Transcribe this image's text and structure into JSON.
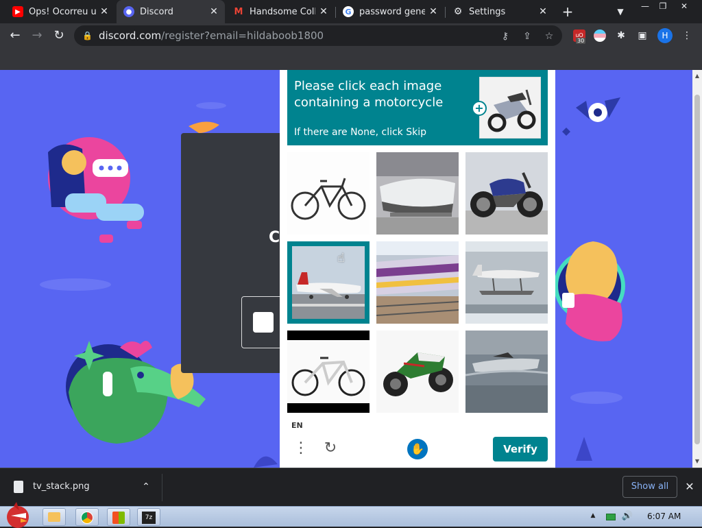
{
  "browser": {
    "tabs": [
      {
        "title": "Ops! Ocorreu um",
        "icon": "youtube-icon",
        "active": false
      },
      {
        "title": "Discord",
        "icon": "discord-icon",
        "active": true
      },
      {
        "title": "Handsome Colla",
        "icon": "gmail-icon",
        "active": false
      },
      {
        "title": "password gener",
        "icon": "google-icon",
        "active": false
      },
      {
        "title": "Settings",
        "icon": "gear-icon",
        "active": false
      }
    ],
    "url_host": "discord.com",
    "url_path": "/register?email=hildaboob1800",
    "extension_badge": "30",
    "profile_initial": "H"
  },
  "captcha": {
    "prompt_line1": "Please click each image containing a motorcycle",
    "prompt_line2": "If there are None, click Skip",
    "tiles": [
      {
        "subject": "bicycle",
        "selected": false
      },
      {
        "subject": "boat",
        "selected": false
      },
      {
        "subject": "motorcycle",
        "selected": false
      },
      {
        "subject": "airplane",
        "selected": true
      },
      {
        "subject": "train",
        "selected": false
      },
      {
        "subject": "seaplane",
        "selected": false
      },
      {
        "subject": "bicycle",
        "selected": false
      },
      {
        "subject": "motorcycle",
        "selected": false
      },
      {
        "subject": "boat",
        "selected": false
      }
    ],
    "language": "EN",
    "verify_label": "Verify",
    "accent_color": "#00838f"
  },
  "page": {
    "background_color": "#5865f2",
    "card_letter": "C"
  },
  "downloads": {
    "file_name": "tv_stack.png",
    "show_all_label": "Show all"
  },
  "taskbar": {
    "clock": "6:07 AM"
  }
}
